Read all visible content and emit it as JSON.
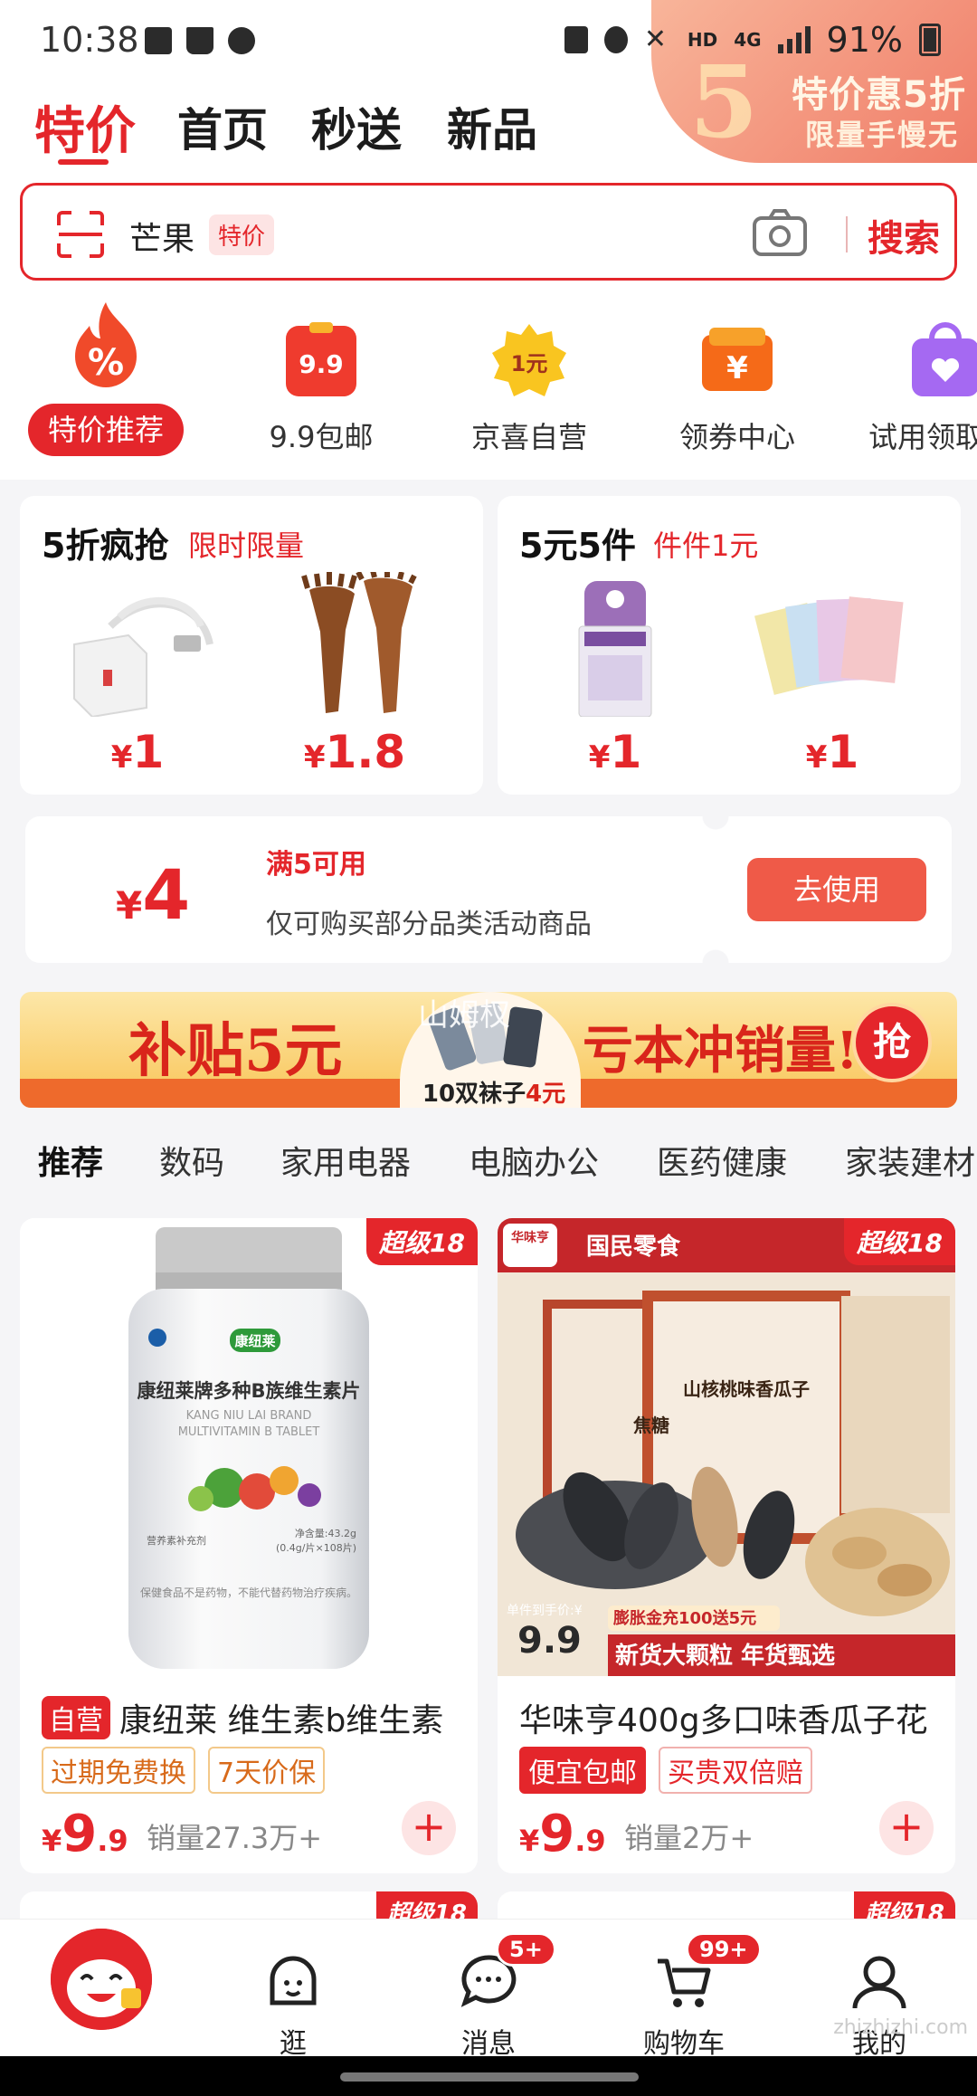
{
  "status_bar": {
    "time": "10:38",
    "battery": "91%",
    "network": "4G",
    "hd": "HD"
  },
  "promo_corner": {
    "big": "5",
    "line1": "特价惠5折",
    "line2": "限量手慢无"
  },
  "top_tabs": [
    "特价",
    "首页",
    "秒送",
    "新品"
  ],
  "search": {
    "text": "芒果",
    "tag": "特价",
    "button": "搜索"
  },
  "categories": [
    {
      "label": "特价推荐",
      "icon": "fire-percent-icon"
    },
    {
      "label": "9.9包邮",
      "icon": "price-tag-icon",
      "icon_text": "9.9"
    },
    {
      "label": "京喜自营",
      "icon": "yuan-badge-icon",
      "icon_text": "1元"
    },
    {
      "label": "领券中心",
      "icon": "coupon-icon",
      "icon_text": "¥"
    },
    {
      "label": "试用领取",
      "icon": "gift-bag-icon"
    }
  ],
  "deals": [
    {
      "title": "5折疯抢",
      "subtitle": "限时限量",
      "items": [
        {
          "price": "1"
        },
        {
          "price": "1.8"
        }
      ]
    },
    {
      "title": "5元5件",
      "subtitle": "件件1元",
      "items": [
        {
          "price": "1"
        },
        {
          "price": "1"
        }
      ]
    }
  ],
  "coupon": {
    "currency": "¥",
    "amount": "4",
    "condition": "满5可用",
    "desc": "仅可购买部分品类活动商品",
    "button": "去使用"
  },
  "banner": {
    "left": "补贴5元",
    "mid": "10双袜子",
    "mid_price": "4元",
    "right": "亏本冲销量!",
    "grab": "抢",
    "watermark": "山姆杈"
  },
  "category_tabs": [
    "推荐",
    "数码",
    "家用电器",
    "电脑办公",
    "医药健康",
    "家装建材"
  ],
  "products": [
    {
      "badge": "超级18",
      "self_tag": "自营",
      "title": "康纽莱 维生素b维生素",
      "tags": [
        "过期免费换",
        "7天价保"
      ],
      "currency": "¥",
      "price_int": "9",
      "price_dec": ".9",
      "sales": "销量27.3万+",
      "image": {
        "brand": "康纽莱",
        "name": "康纽莱牌多种B族维生素片",
        "en1": "KANG NIU LAI BRAND",
        "en2": "MULTIVITAMIN B TABLET",
        "small1": "营养素补充剂",
        "small2": "净含量:43.2g",
        "small3": "(0.4g/片×108片)",
        "note": "保健食品不是药物，不能代替药物治疗疾病。"
      }
    },
    {
      "badge": "超级18",
      "self_tag": "",
      "title": "华味亨400g多口味香瓜子花",
      "tags": [
        "便宜包邮",
        "买贵双倍赔"
      ],
      "currency": "¥",
      "price_int": "9",
      "price_dec": ".9",
      "sales": "销量2万+",
      "image": {
        "brand": "华味亨",
        "series": "国民零食",
        "pack": "山核桃味香瓜子",
        "pack2": "焦糖",
        "price_label": "单件到手价:¥",
        "price": "9.9",
        "promo1": "膨胀金充100送5元",
        "promo2": "新货大颗粒 年货甄选"
      }
    }
  ],
  "peek_badges": [
    "超级18",
    "超级18"
  ],
  "bottom_nav": [
    {
      "label": "",
      "badge": ""
    },
    {
      "label": "逛",
      "badge": ""
    },
    {
      "label": "消息",
      "badge": "5+"
    },
    {
      "label": "购物车",
      "badge": "99+"
    },
    {
      "label": "我的",
      "badge": ""
    }
  ],
  "watermark": "zhizhizhi.com"
}
